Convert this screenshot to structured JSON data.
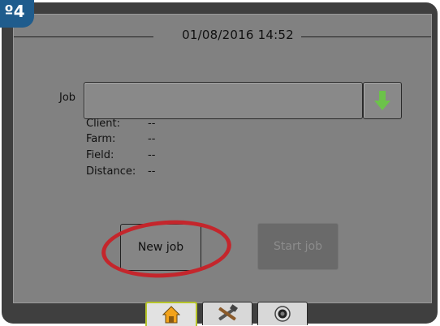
{
  "step": {
    "label": "º4"
  },
  "header": {
    "datetime": "01/08/2016 14:52"
  },
  "job": {
    "label": "Job",
    "value": ""
  },
  "details": [
    {
      "label": "Client:",
      "value": "--"
    },
    {
      "label": "Farm:",
      "value": "--"
    },
    {
      "label": "Field:",
      "value": "--"
    },
    {
      "label": "Distance:",
      "value": "--"
    }
  ],
  "buttons": {
    "new_job": "New job",
    "start_job": "Start job"
  },
  "tabs": [
    {
      "icon": "home-icon",
      "active": true
    },
    {
      "icon": "tools-icon",
      "active": false
    },
    {
      "icon": "camera-icon",
      "active": false
    }
  ],
  "colors": {
    "highlight": "#c4262c",
    "arrow": "#6cc24a",
    "badge": "#1f5c8d"
  }
}
